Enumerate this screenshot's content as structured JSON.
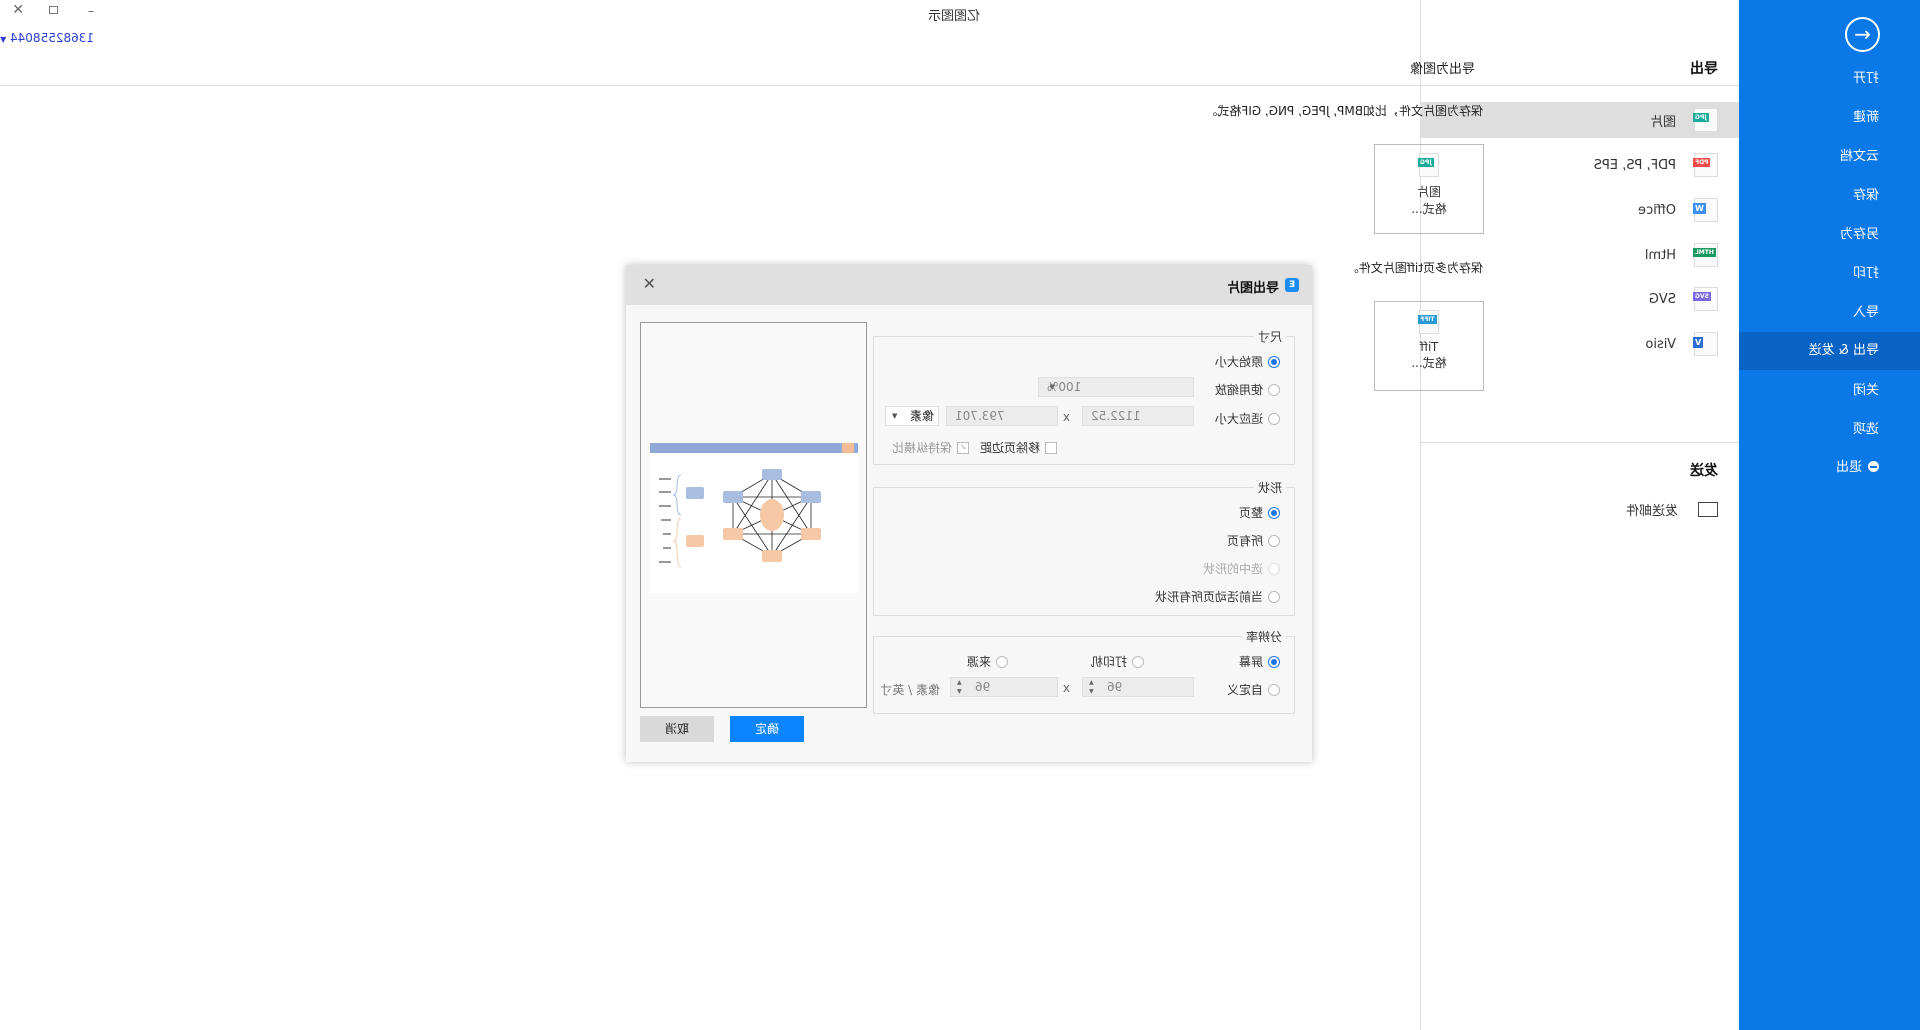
{
  "app": {
    "title": "亿图图示",
    "user_id": "13682558044"
  },
  "colors": {
    "sidebar": "#0b78e8",
    "sidebar_active": "#0863c4",
    "primary_button": "#0a84ff"
  },
  "sidebar": {
    "items": [
      {
        "label": "打开"
      },
      {
        "label": "新建"
      },
      {
        "label": "云文档"
      },
      {
        "label": "保存"
      },
      {
        "label": "另存为"
      },
      {
        "label": "打印"
      },
      {
        "label": "导入"
      },
      {
        "label": "导出 & 发送",
        "active": true
      },
      {
        "label": "关闭"
      },
      {
        "label": "选项"
      },
      {
        "label": "退出",
        "icon": "minus-circle-icon"
      }
    ]
  },
  "export_panel": {
    "title": "导出",
    "items": [
      {
        "label": "图片",
        "badge": "JPG",
        "color": "#1aab9b"
      },
      {
        "label": "PDF, PS, EPS",
        "badge": "PDF",
        "color": "#f04a4a"
      },
      {
        "label": "Office",
        "badge": "W",
        "color": "#3a8ff0"
      },
      {
        "label": "Html",
        "badge": "HTML",
        "color": "#1a9a60"
      },
      {
        "label": "SVG",
        "badge": "SVG",
        "color": "#7a6ae0"
      },
      {
        "label": "Visio",
        "badge": "V",
        "color": "#2b6fd6"
      }
    ],
    "send_title": "发送",
    "send_items": [
      {
        "label": "发送邮件"
      }
    ]
  },
  "main": {
    "title": "导出为图像",
    "desc1": "保存为图片文件，比如BMP, JPEG, PNG, GIF格式。",
    "card1": {
      "badge": "JPG",
      "line1": "图片",
      "line2": "格式..."
    },
    "desc2": "保存为多页tiff图片文件。",
    "card2": {
      "badge": "TIFF",
      "line1": "Tiff",
      "line2": "格式..."
    }
  },
  "dialog": {
    "title": "导出图片",
    "size": {
      "legend": "尺寸",
      "original": "原始大小",
      "zoom": "使用缩放",
      "zoom_value": "100%",
      "fit": "适应大小",
      "width": "1122.52",
      "height": "793.701",
      "x": "x",
      "unit": "像素",
      "remove_margin": "移除页边距",
      "keep_ratio": "保持纵横比",
      "selected": "原始大小"
    },
    "shape": {
      "legend": "形状",
      "options": [
        "整页",
        "所有页",
        "选中的形状",
        "当前活动页所有形状"
      ],
      "selected": "整页"
    },
    "resolution": {
      "legend": "分辨率",
      "screen": "屏幕",
      "printer": "打印机",
      "source": "来源",
      "custom": "自定义",
      "dpi_x": "96",
      "dpi_y": "96",
      "x": "x",
      "unit": "像素 / 英寸",
      "selected": "屏幕"
    },
    "ok": "确定",
    "cancel": "取消"
  }
}
